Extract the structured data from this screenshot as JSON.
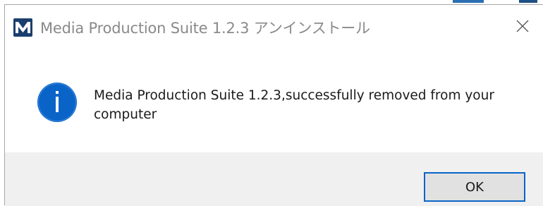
{
  "window": {
    "title": "Media Production Suite 1.2.3 アンインストール",
    "app_icon": "media-production-suite-logo",
    "close_icon": "close-x-icon"
  },
  "message": {
    "icon": "info-icon",
    "text": "Media Production Suite 1.2.3,successfully removed from your computer"
  },
  "buttons": {
    "ok_label": "OK"
  },
  "colors": {
    "info_blue": "#0a64c8",
    "button_focus_border": "#0a64c8",
    "footer_bg": "#f0f0f0",
    "title_text": "#8a8a8a",
    "logo_bg": "#1a3f6e"
  }
}
